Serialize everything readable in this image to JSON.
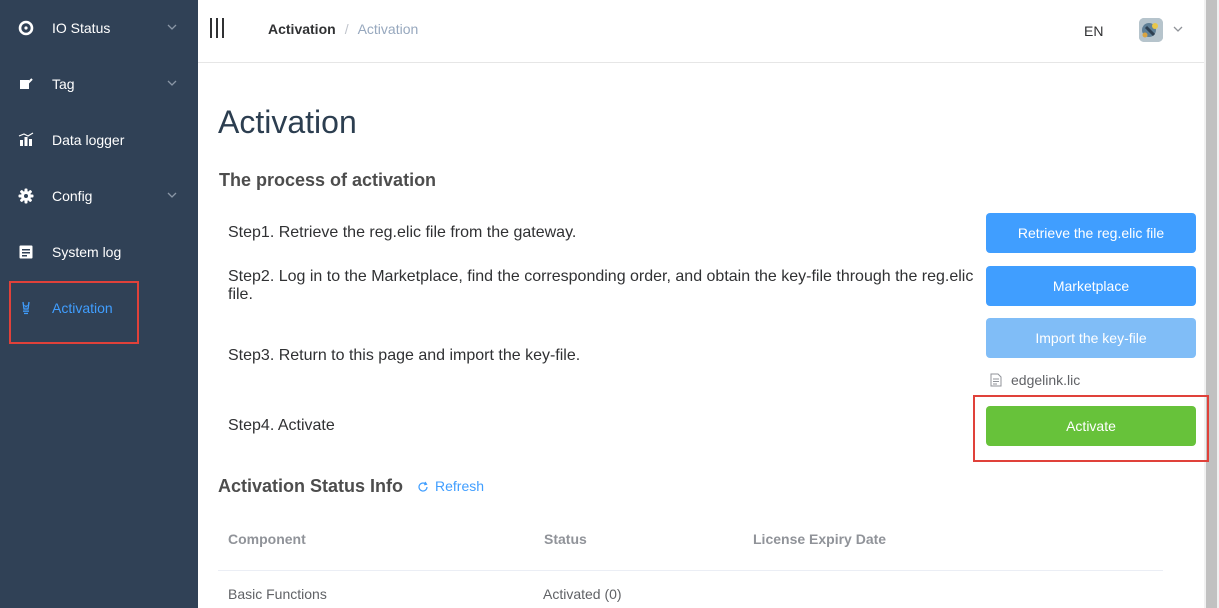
{
  "sidebar": {
    "items": [
      {
        "label": "IO Status",
        "icon": "io-status-icon"
      },
      {
        "label": "Tag",
        "icon": "tag-icon"
      },
      {
        "label": "Data logger",
        "icon": "chart-icon"
      },
      {
        "label": "Config",
        "icon": "gear-icon"
      },
      {
        "label": "System log",
        "icon": "log-icon"
      },
      {
        "label": "Activation",
        "icon": "activation-icon"
      }
    ],
    "active": "Activation"
  },
  "header": {
    "breadcrumb": [
      "Activation",
      "Activation"
    ],
    "separator": "/",
    "lang": "EN"
  },
  "main": {
    "title": "Activation",
    "process_title": "The process of activation",
    "steps": [
      "Step1. Retrieve the reg.elic file from the gateway.",
      "Step2. Log in to the Marketplace, find the corresponding order, and obtain the key-file through the reg.elic file.",
      "Step3. Return to this page and import the key-file.",
      "Step4. Activate"
    ],
    "buttons": {
      "retrieve": "Retrieve the reg.elic file",
      "marketplace": "Marketplace",
      "import": "Import the key-file",
      "activate": "Activate"
    },
    "file_name": "edgelink.lic"
  },
  "status": {
    "title": "Activation Status Info",
    "refresh": "Refresh",
    "columns": [
      "Component",
      "Status",
      "License Expiry Date"
    ],
    "rows": [
      {
        "component": "Basic Functions",
        "status": "Activated (0)",
        "expiry": ""
      }
    ]
  },
  "colors": {
    "sidebar_bg": "#304156",
    "primary": "#409eff",
    "success": "#67c23a",
    "highlight": "#e0413a"
  }
}
